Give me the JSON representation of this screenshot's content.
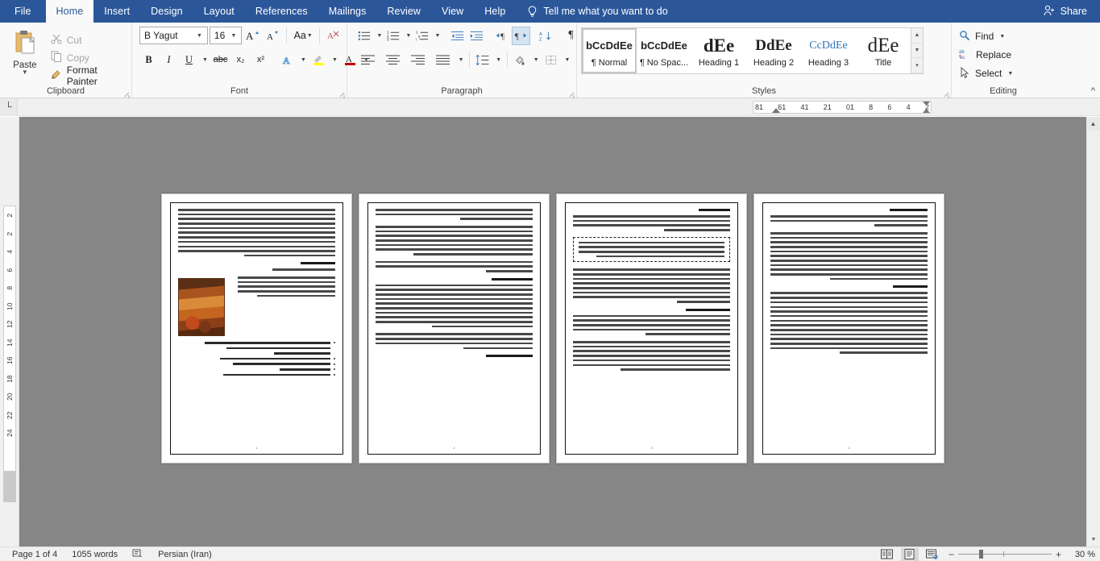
{
  "app": {
    "tabs": [
      {
        "label": "File",
        "active": false
      },
      {
        "label": "Home",
        "active": true
      },
      {
        "label": "Insert",
        "active": false
      },
      {
        "label": "Design",
        "active": false
      },
      {
        "label": "Layout",
        "active": false
      },
      {
        "label": "References",
        "active": false
      },
      {
        "label": "Mailings",
        "active": false
      },
      {
        "label": "Review",
        "active": false
      },
      {
        "label": "View",
        "active": false
      },
      {
        "label": "Help",
        "active": false
      }
    ],
    "tell_me": "Tell me what you want to do",
    "share": "Share",
    "accent_color": "#2b579a"
  },
  "clipboard": {
    "group_label": "Clipboard",
    "paste_label": "Paste",
    "cut_label": "Cut",
    "copy_label": "Copy",
    "format_painter_label": "Format Painter"
  },
  "font": {
    "group_label": "Font",
    "name_value": "B Yagut",
    "size_value": "16",
    "grow_label": "A",
    "shrink_label": "A",
    "change_case_label": "Aa",
    "clear_format_label": "clear-formatting",
    "bold_label": "B",
    "italic_label": "I",
    "underline_label": "U",
    "strikethrough_label": "abc",
    "subscript_label": "x₂",
    "superscript_label": "x²",
    "text_effects_label": "A",
    "highlight_label": "ab",
    "font_color_label": "A"
  },
  "paragraph": {
    "group_label": "Paragraph",
    "bullets_label": "bullet-list",
    "numbering_label": "numbered-list",
    "multilevel_label": "multilevel-list",
    "decrease_indent_label": "decrease-indent",
    "increase_indent_label": "increase-indent",
    "ltr_label": "▶¶",
    "rtl_label": "¶◀",
    "sort_label": "AZ",
    "marks_label": "¶",
    "align_left_label": "align-left",
    "align_center_label": "align-center",
    "align_right_label": "align-right",
    "justify_label": "justify",
    "line_spacing_label": "line-spacing",
    "shading_label": "shading",
    "borders_label": "borders"
  },
  "styles": {
    "group_label": "Styles",
    "items": [
      {
        "preview": "bCcDdEe",
        "name": "¶ Normal",
        "selected": true
      },
      {
        "preview": "bCcDdEe",
        "name": "¶ No Spac...",
        "selected": false
      },
      {
        "preview": "dEe",
        "name": "Heading 1",
        "selected": false
      },
      {
        "preview": "DdEe",
        "name": "Heading 2",
        "selected": false
      },
      {
        "preview": "CcDdEe",
        "name": "Heading 3",
        "selected": false
      },
      {
        "preview": "dEe",
        "name": "Title",
        "selected": false
      }
    ]
  },
  "editing": {
    "group_label": "Editing",
    "find_label": "Find",
    "replace_label": "Replace",
    "select_label": "Select"
  },
  "ruler": {
    "tabstop_marker": "└",
    "horizontal_numbers": [
      "81",
      "61",
      "41",
      "21",
      "01",
      "8",
      "6",
      "4",
      "2"
    ],
    "vertical_numbers": [
      "2",
      "2",
      "4",
      "6",
      "8",
      "10",
      "12",
      "14",
      "16",
      "18",
      "20",
      "22",
      "24"
    ]
  },
  "document": {
    "pages": [
      {
        "page_number": "1",
        "blocks": [
          {
            "type": "paragraph",
            "lines": 11
          },
          {
            "type": "heading",
            "lines": 1
          },
          {
            "type": "paragraph",
            "lines": 1
          },
          {
            "type": "image",
            "lines": 0
          },
          {
            "type": "paragraph",
            "lines": 5
          },
          {
            "type": "paragraph",
            "lines": 3
          },
          {
            "type": "bullets",
            "lines": 8
          }
        ]
      },
      {
        "page_number": "2",
        "blocks": [
          {
            "type": "paragraph",
            "lines": 3
          },
          {
            "type": "paragraph",
            "lines": 7
          },
          {
            "type": "paragraph",
            "lines": 3
          },
          {
            "type": "heading",
            "lines": 1
          },
          {
            "type": "paragraph",
            "lines": 10
          },
          {
            "type": "paragraph",
            "lines": 4
          },
          {
            "type": "heading",
            "lines": 1
          }
        ]
      },
      {
        "page_number": "3",
        "blocks": [
          {
            "type": "heading",
            "lines": 1
          },
          {
            "type": "paragraph",
            "lines": 4
          },
          {
            "type": "quote",
            "lines": 4
          },
          {
            "type": "paragraph",
            "lines": 8
          },
          {
            "type": "heading",
            "lines": 1
          },
          {
            "type": "paragraph",
            "lines": 5
          },
          {
            "type": "paragraph",
            "lines": 8
          }
        ]
      },
      {
        "page_number": "4",
        "blocks": [
          {
            "type": "heading",
            "lines": 1
          },
          {
            "type": "paragraph",
            "lines": 3
          },
          {
            "type": "paragraph",
            "lines": 11
          },
          {
            "type": "heading",
            "lines": 1
          },
          {
            "type": "paragraph",
            "lines": 14
          }
        ]
      }
    ]
  },
  "status": {
    "page_label": "Page 1 of 4",
    "word_count": "1055 words",
    "proofing_icon": "proofing-icon",
    "language": "Persian (Iran)",
    "view_read": "read-mode-icon",
    "view_print": "print-layout-icon",
    "view_web": "web-layout-icon",
    "zoom_out": "−",
    "zoom_in": "+",
    "zoom_value": "30 %"
  }
}
